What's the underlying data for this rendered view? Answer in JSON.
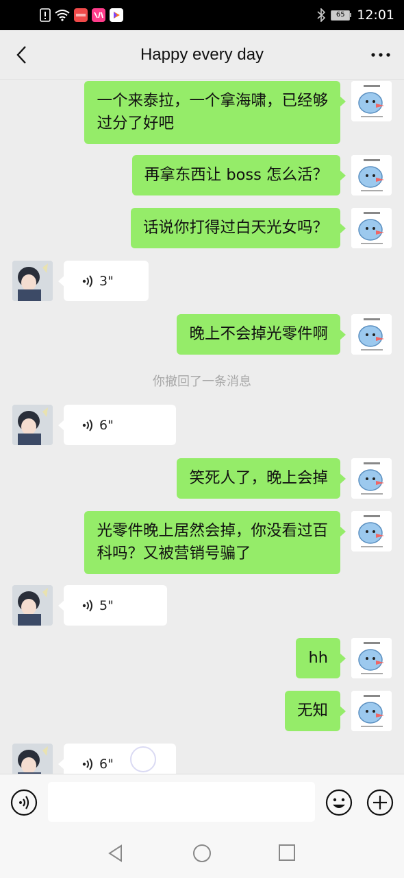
{
  "status_bar": {
    "time": "12:01",
    "battery": "65",
    "left_icons": [
      "alert-icon",
      "wifi-icon",
      "huawei-video-app-icon",
      "youku-app-icon",
      "video-app-icon"
    ],
    "right_icons": [
      "bluetooth-icon",
      "battery-icon"
    ]
  },
  "header": {
    "title": "Happy every day",
    "back_icon": "chevron-left-icon",
    "more_icon": "more-dots-icon"
  },
  "messages": [
    {
      "side": "right",
      "type": "text",
      "text_lines": [
        "一个来泰拉，一个拿海啸，已经够",
        "过分了好吧"
      ]
    },
    {
      "side": "right",
      "type": "text",
      "text_lines": [
        "再拿东西让 boss 怎么活？"
      ]
    },
    {
      "side": "right",
      "type": "text",
      "text_lines": [
        "话说你打得过白天光女吗？"
      ]
    },
    {
      "side": "left",
      "type": "voice",
      "duration": "3\""
    },
    {
      "side": "right",
      "type": "text",
      "text_lines": [
        "晚上不会掉光零件啊"
      ]
    },
    {
      "type": "system",
      "text": "你撤回了一条消息"
    },
    {
      "side": "left",
      "type": "voice",
      "duration": "6\""
    },
    {
      "side": "right",
      "type": "text",
      "text_lines": [
        "笑死人了，晚上会掉"
      ]
    },
    {
      "side": "right",
      "type": "text",
      "text_lines": [
        "光零件晚上居然会掉，你没看过百",
        "科吗？又被营销号骗了"
      ]
    },
    {
      "side": "left",
      "type": "voice",
      "duration": "5\""
    },
    {
      "side": "right",
      "type": "text",
      "text_lines": [
        "hh"
      ]
    },
    {
      "side": "right",
      "type": "text",
      "text_lines": [
        "无知"
      ]
    },
    {
      "side": "left",
      "type": "voice",
      "duration": "6\""
    }
  ],
  "input_bar": {
    "voice_icon": "voice-input-icon",
    "emoji_icon": "emoji-icon",
    "plus_icon": "plus-icon",
    "value": ""
  },
  "nav_bar": {
    "icons": [
      "nav-back-icon",
      "nav-home-icon",
      "nav-recents-icon"
    ]
  },
  "colors": {
    "bubble_self": "#95ec69",
    "bubble_other": "#ffffff",
    "background": "#ededed"
  }
}
